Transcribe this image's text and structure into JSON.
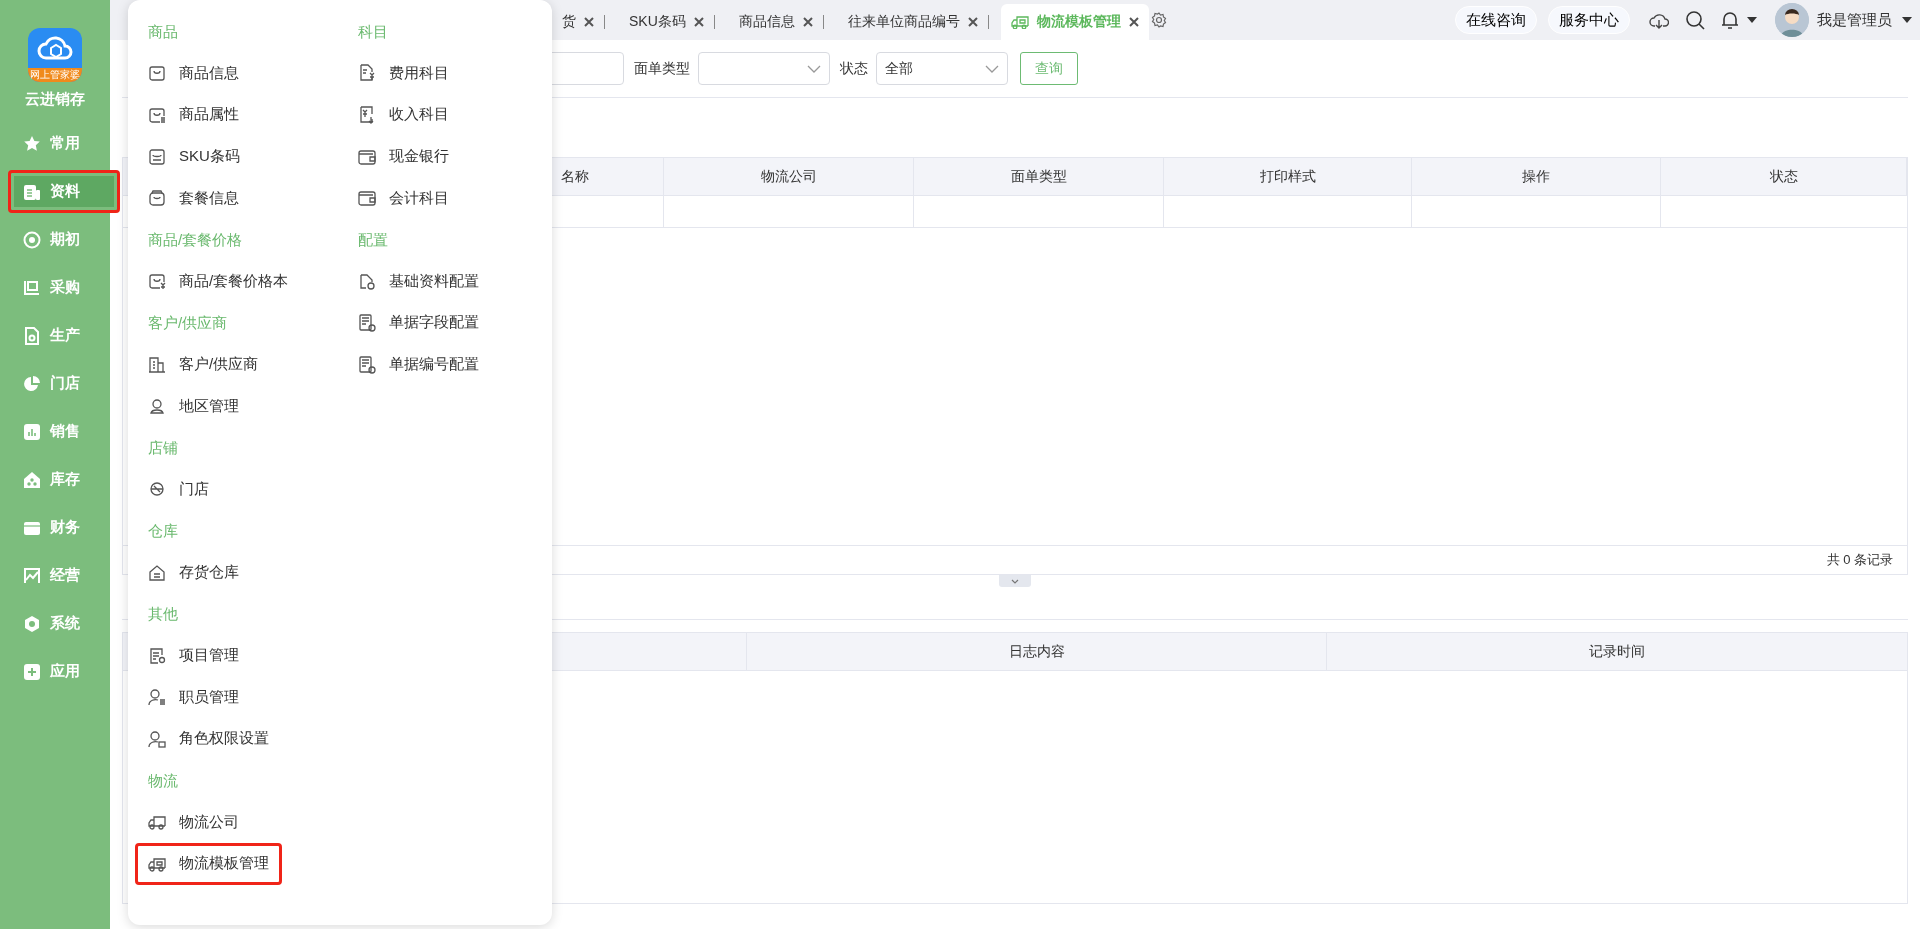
{
  "sidebar": {
    "logo_badge": "网上管家婆",
    "app_name": "云进销存",
    "items": [
      {
        "label": "常用",
        "selected": false,
        "highlighted": false
      },
      {
        "label": "资料",
        "selected": true,
        "highlighted": true
      },
      {
        "label": "期初",
        "selected": false,
        "highlighted": false
      },
      {
        "label": "采购",
        "selected": false,
        "highlighted": false
      },
      {
        "label": "生产",
        "selected": false,
        "highlighted": false
      },
      {
        "label": "门店",
        "selected": false,
        "highlighted": false
      },
      {
        "label": "销售",
        "selected": false,
        "highlighted": false
      },
      {
        "label": "库存",
        "selected": false,
        "highlighted": false
      },
      {
        "label": "财务",
        "selected": false,
        "highlighted": false
      },
      {
        "label": "经营",
        "selected": false,
        "highlighted": false
      },
      {
        "label": "系统",
        "selected": false,
        "highlighted": false
      },
      {
        "label": "应用",
        "selected": false,
        "highlighted": false
      }
    ]
  },
  "tabs": [
    {
      "label": "货",
      "selected": false
    },
    {
      "label": "SKU条码",
      "selected": false
    },
    {
      "label": "商品信息",
      "selected": false
    },
    {
      "label": "往来单位商品编号",
      "selected": false
    },
    {
      "label": "物流模板管理",
      "selected": true
    }
  ],
  "header": {
    "buttons": [
      "在线咨询",
      "服务中心"
    ],
    "user_name": "我是管理员"
  },
  "filters": {
    "fields": [
      {
        "label": "面单类型"
      },
      {
        "label": "状态",
        "value": "全部"
      }
    ],
    "query_button": "查询"
  },
  "table": {
    "columns": [
      "名称",
      "物流公司",
      "面单类型",
      "打印样式",
      "操作",
      "状态"
    ],
    "footer": "共 0 条记录"
  },
  "log_table": {
    "columns": [
      "日志内容",
      "记录时间"
    ]
  },
  "menu": {
    "columns": [
      {
        "sections": [
          {
            "title": "商品",
            "items": [
              {
                "label": "商品信息",
                "highlighted": false
              },
              {
                "label": "商品属性",
                "highlighted": false
              },
              {
                "label": "SKU条码",
                "highlighted": false
              },
              {
                "label": "套餐信息",
                "highlighted": false
              }
            ]
          },
          {
            "title": "商品/套餐价格",
            "items": [
              {
                "label": "商品/套餐价格本",
                "highlighted": false
              }
            ]
          },
          {
            "title": "客户/供应商",
            "items": [
              {
                "label": "客户/供应商",
                "highlighted": false
              },
              {
                "label": "地区管理",
                "highlighted": false
              }
            ]
          },
          {
            "title": "店铺",
            "items": [
              {
                "label": "门店",
                "highlighted": false
              }
            ]
          },
          {
            "title": "仓库",
            "items": [
              {
                "label": "存货仓库",
                "highlighted": false
              }
            ]
          },
          {
            "title": "其他",
            "items": [
              {
                "label": "项目管理",
                "highlighted": false
              },
              {
                "label": "职员管理",
                "highlighted": false
              },
              {
                "label": "角色权限设置",
                "highlighted": false
              }
            ]
          },
          {
            "title": "物流",
            "items": [
              {
                "label": "物流公司",
                "highlighted": false
              },
              {
                "label": "物流模板管理",
                "highlighted": true
              }
            ]
          }
        ]
      },
      {
        "sections": [
          {
            "title": "科目",
            "items": [
              {
                "label": "费用科目",
                "highlighted": false
              },
              {
                "label": "收入科目",
                "highlighted": false
              },
              {
                "label": "现金银行",
                "highlighted": false
              },
              {
                "label": "会计科目",
                "highlighted": false
              }
            ]
          },
          {
            "title": "配置",
            "items": [
              {
                "label": "基础资料配置",
                "highlighted": false
              },
              {
                "label": "单据字段配置",
                "highlighted": false
              },
              {
                "label": "单据编号配置",
                "highlighted": false
              }
            ]
          }
        ]
      }
    ]
  }
}
